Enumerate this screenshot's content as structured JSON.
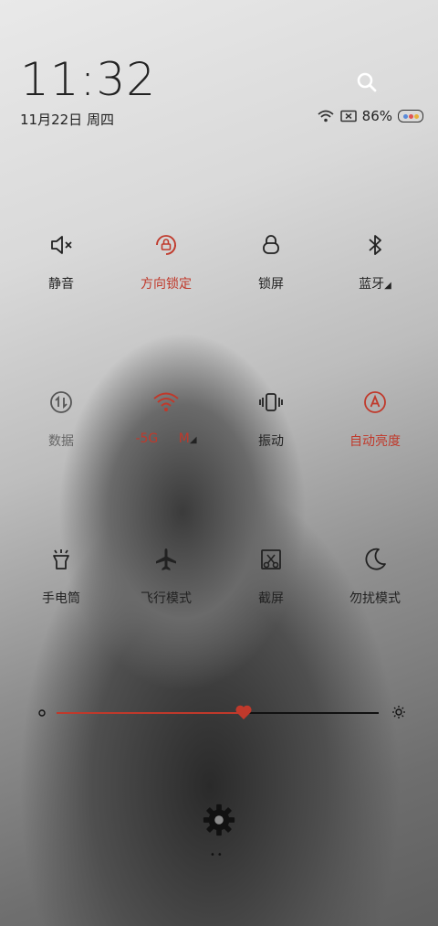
{
  "status": {
    "time": "11:32",
    "date": "11月22日 周四",
    "battery": "86%"
  },
  "tiles": [
    {
      "label": "静音",
      "icon": "mute-icon",
      "state": "off"
    },
    {
      "label": "方向锁定",
      "icon": "rotation-lock-icon",
      "state": "on"
    },
    {
      "label": "锁屏",
      "icon": "lock-icon",
      "state": "off"
    },
    {
      "label": "蓝牙",
      "icon": "bluetooth-icon",
      "state": "off"
    },
    {
      "label": "数据",
      "icon": "mobile-data-icon",
      "state": "dim"
    },
    {
      "label": "-5G M",
      "icon": "wifi-icon",
      "state": "on"
    },
    {
      "label": "振动",
      "icon": "vibrate-icon",
      "state": "off"
    },
    {
      "label": "自动亮度",
      "icon": "auto-brightness-icon",
      "state": "on"
    },
    {
      "label": "手电筒",
      "icon": "flashlight-icon",
      "state": "off"
    },
    {
      "label": "飞行模式",
      "icon": "airplane-icon",
      "state": "off"
    },
    {
      "label": "截屏",
      "icon": "screenshot-icon",
      "state": "off"
    },
    {
      "label": "勿扰模式",
      "icon": "moon-icon",
      "state": "off"
    }
  ],
  "brightness": {
    "level": 0.58
  },
  "colors": {
    "accent": "#c0392b",
    "text": "#222222"
  },
  "page_indicator": "••"
}
